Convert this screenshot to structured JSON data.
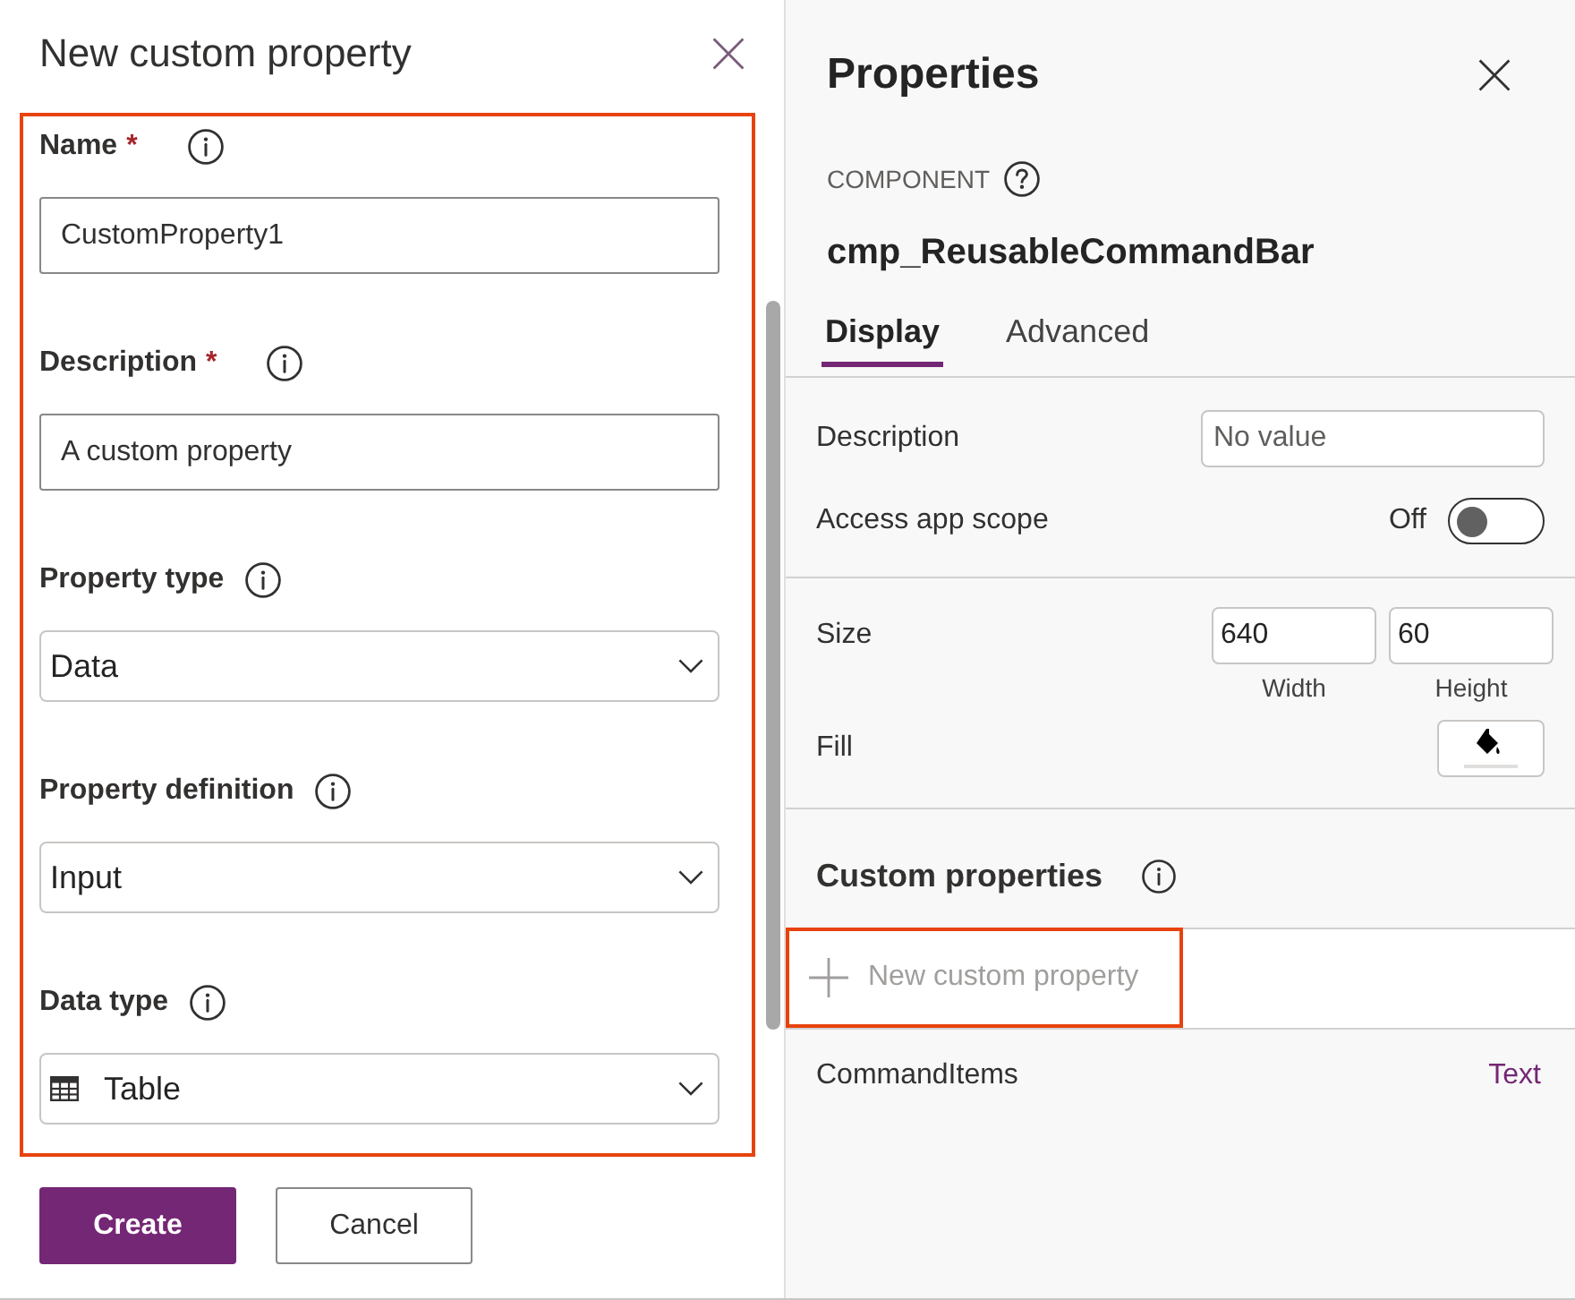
{
  "dialog": {
    "title": "New custom property",
    "highlighted": true,
    "fields": [
      {
        "kind": "text",
        "label": "Name",
        "required_mark": "*",
        "value": "CustomProperty1"
      },
      {
        "kind": "text",
        "label": "Description",
        "required_mark": "*",
        "value": "A custom property"
      },
      {
        "kind": "dropdown",
        "label": "Property type",
        "value": "Data"
      },
      {
        "kind": "dropdown",
        "label": "Property definition",
        "value": "Input"
      },
      {
        "kind": "table-dropdown",
        "label": "Data type",
        "value": "Table"
      }
    ],
    "buttons": [
      {
        "label": "Create",
        "primary": true
      },
      {
        "label": "Cancel",
        "primary": false
      }
    ]
  },
  "properties": {
    "title": "Properties",
    "section_label": "COMPONENT",
    "component_name": "cmp_ReusableCommandBar",
    "tabs": [
      {
        "label": "Display",
        "selected": true
      },
      {
        "label": "Advanced",
        "selected": false
      }
    ],
    "description": {
      "label": "Description",
      "placeholder": "No value"
    },
    "access_app_scope": {
      "label": "Access app scope",
      "state_text": "Off",
      "on": false
    },
    "size": {
      "label": "Size",
      "width": {
        "value": "640",
        "caption": "Width"
      },
      "height": {
        "value": "60",
        "caption": "Height"
      }
    },
    "fill": {
      "label": "Fill"
    },
    "custom_properties": {
      "title": "Custom properties",
      "new_button": {
        "label": "New custom property",
        "highlighted": true
      },
      "items": [
        {
          "name": "CommandItems",
          "type": "Text"
        }
      ]
    }
  }
}
